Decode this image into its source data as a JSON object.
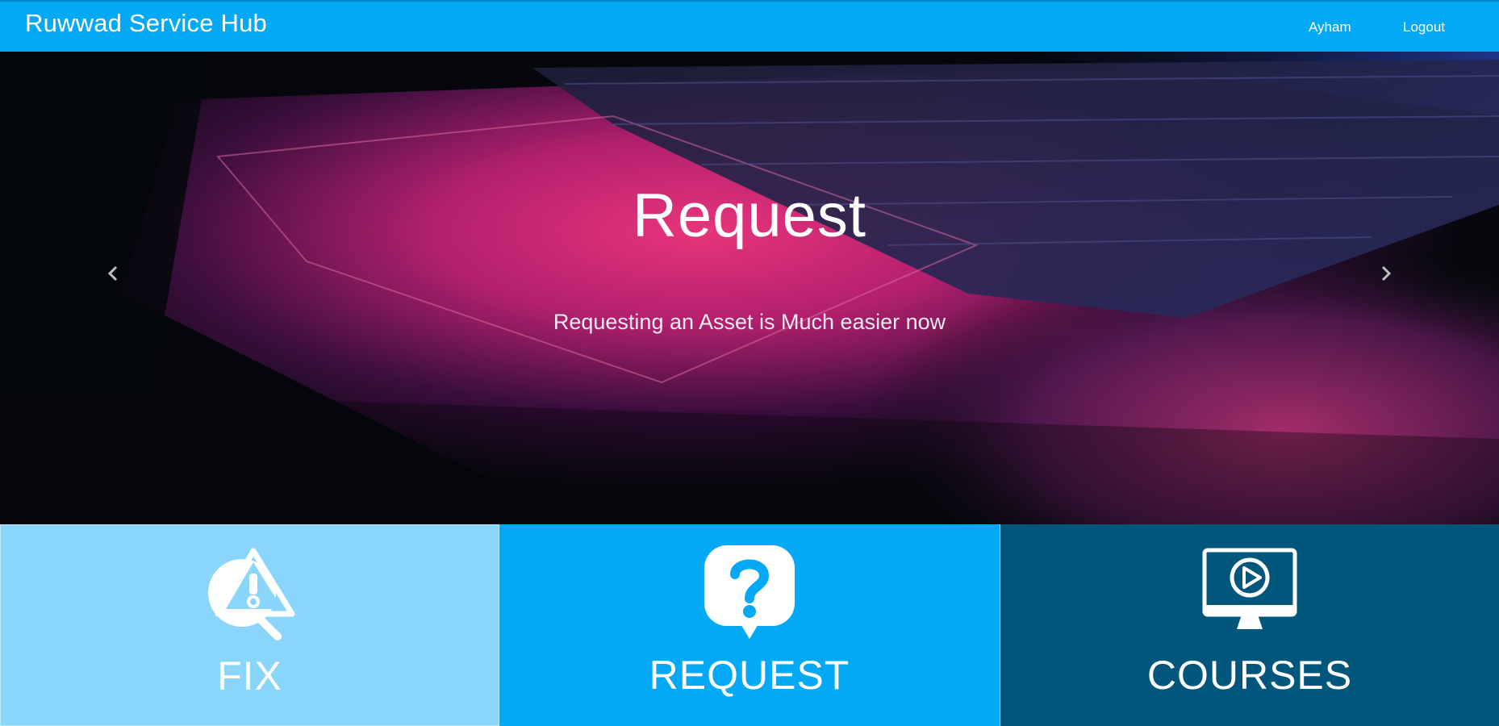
{
  "navbar": {
    "brand": "Ruwwad Service Hub",
    "user": "Ayham",
    "logout": "Logout",
    "color": "#03a9f4"
  },
  "carousel": {
    "slide": {
      "title": "Request",
      "caption": "Requesting an Asset is Much easier now"
    },
    "prev_icon": "chevron-left-icon",
    "next_icon": "chevron-right-icon"
  },
  "tiles": [
    {
      "label": "FIX",
      "icon": "warning-search-icon",
      "color": "#8ad5fa"
    },
    {
      "label": "REQUEST",
      "icon": "question-bubble-icon",
      "color": "#03a9f4"
    },
    {
      "label": "COURSES",
      "icon": "video-monitor-icon",
      "color": "#01567b"
    }
  ]
}
